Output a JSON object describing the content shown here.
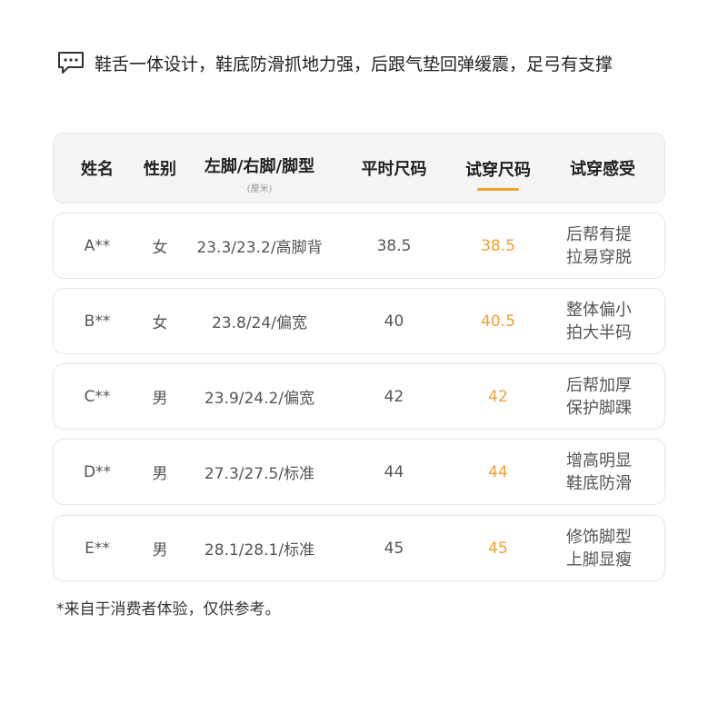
{
  "feature": {
    "icon": "chat-bubble-icon",
    "text": "鞋舌一体设计，鞋底防滑抓地力强，后跟气垫回弹缓震，足弓有支撑"
  },
  "table": {
    "headers": {
      "name": "姓名",
      "gender": "性别",
      "foot": "左脚/右脚/脚型",
      "foot_unit": "(厘米)",
      "usual_size": "平时尺码",
      "trial_size": "试穿尺码",
      "feeling": "试穿感受"
    },
    "accent_color": "#f0a030",
    "rows": [
      {
        "name": "A**",
        "gender": "女",
        "foot": "23.3/23.2/高脚背",
        "usual_size": "38.5",
        "trial_size": "38.5",
        "feeling_line1": "后帮有提",
        "feeling_line2": "拉易穿脱"
      },
      {
        "name": "B**",
        "gender": "女",
        "foot": "23.8/24/偏宽",
        "usual_size": "40",
        "trial_size": "40.5",
        "feeling_line1": "整体偏小",
        "feeling_line2": "拍大半码"
      },
      {
        "name": "C**",
        "gender": "男",
        "foot": "23.9/24.2/偏宽",
        "usual_size": "42",
        "trial_size": "42",
        "feeling_line1": "后帮加厚",
        "feeling_line2": "保护脚踝"
      },
      {
        "name": "D**",
        "gender": "男",
        "foot": "27.3/27.5/标准",
        "usual_size": "44",
        "trial_size": "44",
        "feeling_line1": "增高明显",
        "feeling_line2": "鞋底防滑"
      },
      {
        "name": "E**",
        "gender": "男",
        "foot": "28.1/28.1/标准",
        "usual_size": "45",
        "trial_size": "45",
        "feeling_line1": "修饰脚型",
        "feeling_line2": "上脚显瘦"
      }
    ]
  },
  "footnote": "*来自于消费者体验，仅供参考。"
}
